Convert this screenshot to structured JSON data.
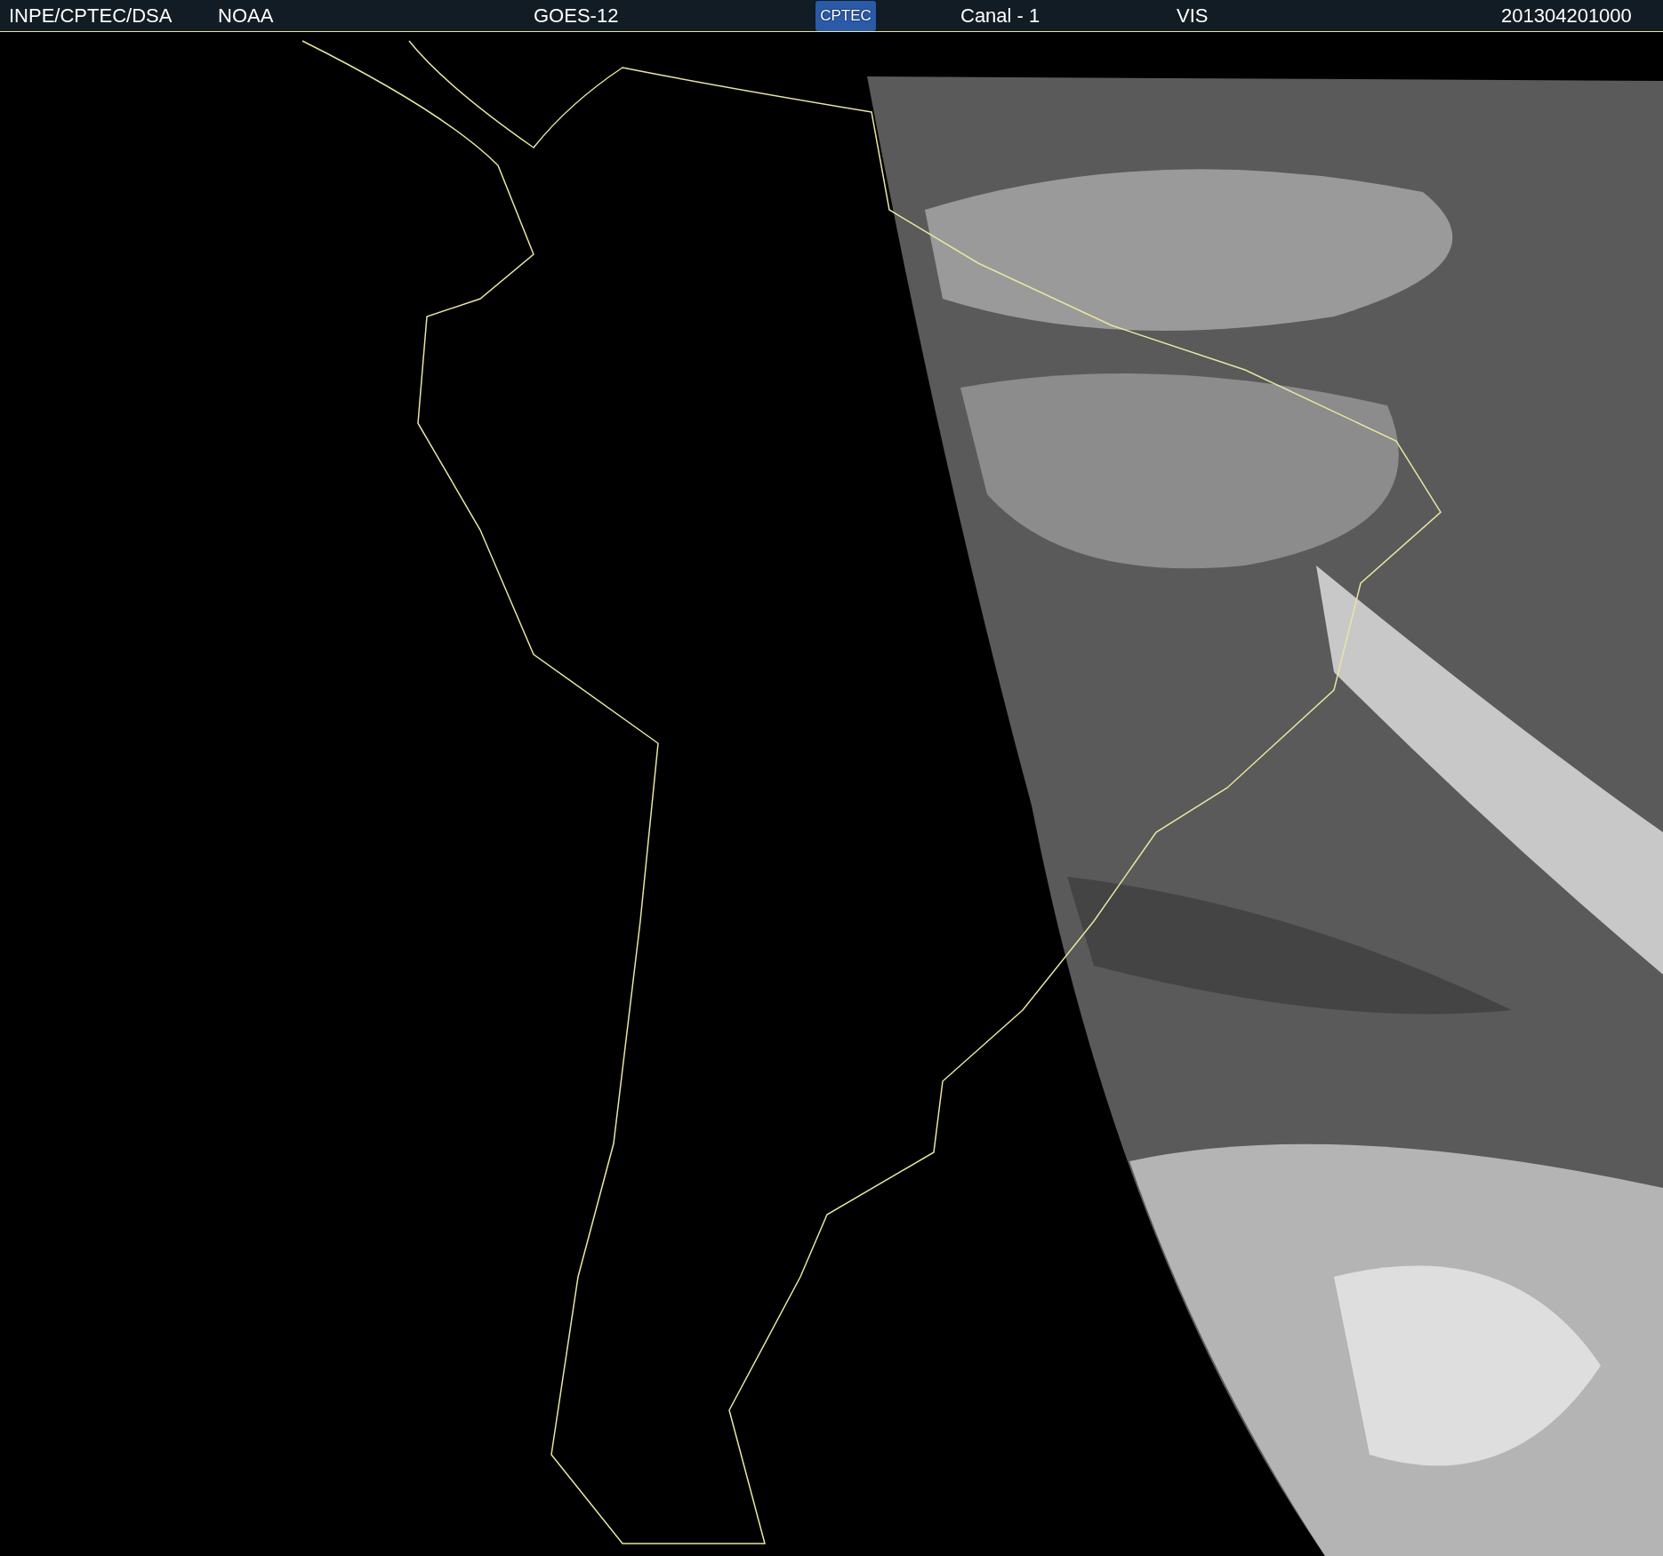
{
  "header": {
    "source": "INPE/CPTEC/DSA",
    "agency": "NOAA",
    "satellite": "GOES-12",
    "logo": "CPTEC",
    "channel": "Canal - 1",
    "band": "VIS",
    "timestamp": "201304201000"
  }
}
